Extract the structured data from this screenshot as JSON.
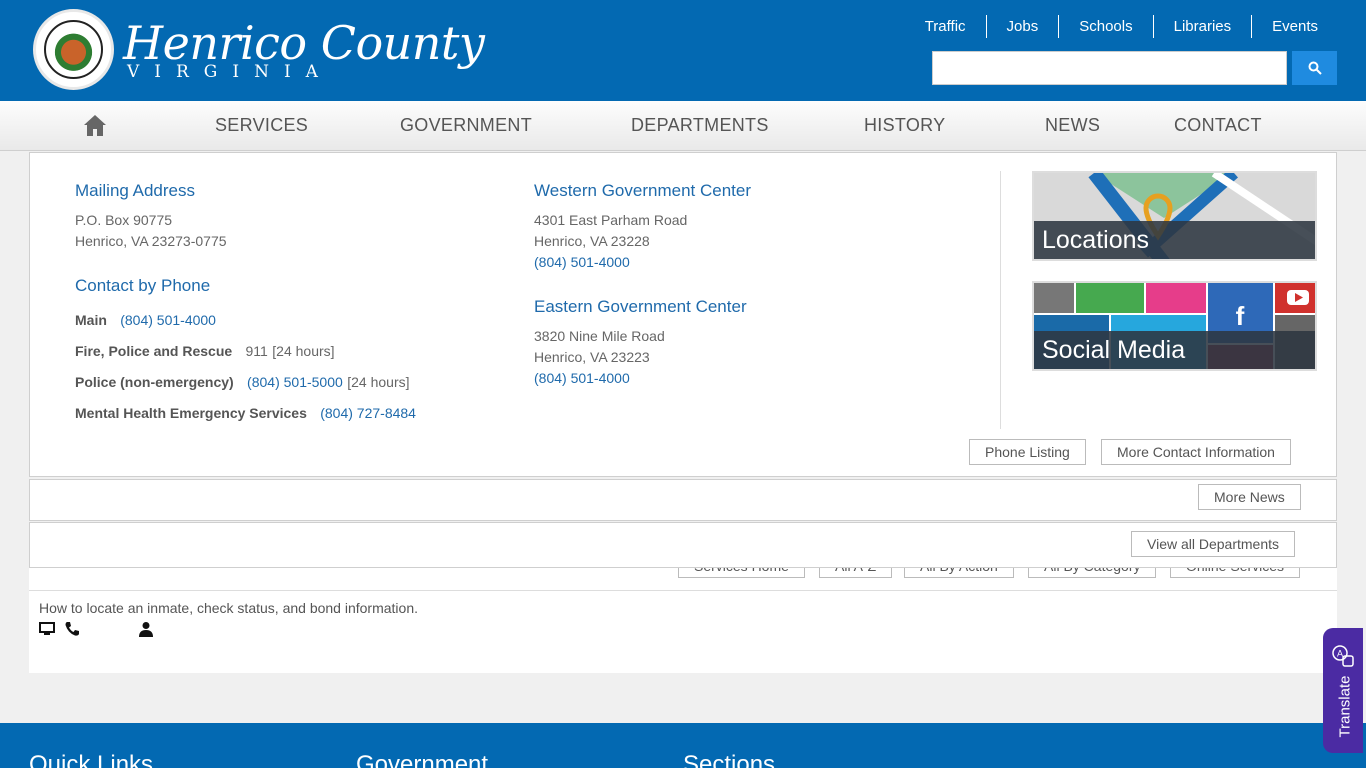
{
  "header": {
    "brand_name": "Henrico County",
    "brand_sub": "VIRGINIA",
    "top_links": [
      "Traffic",
      "Jobs",
      "Schools",
      "Libraries",
      "Events"
    ],
    "search_placeholder": ""
  },
  "nav": {
    "items": [
      "SERVICES",
      "GOVERNMENT",
      "DEPARTMENTS",
      "HISTORY",
      "NEWS",
      "CONTACT"
    ]
  },
  "contact": {
    "mailing_title": "Mailing Address",
    "mailing_line1": "P.O. Box 90775",
    "mailing_line2": "Henrico, VA 23273-0775",
    "phone_title": "Contact by Phone",
    "phones": [
      {
        "label": "Main",
        "value": "(804) 501-4000",
        "extra": ""
      },
      {
        "label": "Fire, Police and Rescue",
        "value": "911",
        "extra": "[24 hours]"
      },
      {
        "label": "Police (non-emergency)",
        "value": "(804) 501-5000",
        "extra": "[24 hours]"
      },
      {
        "label": "Mental Health Emergency Services",
        "value": "(804) 727-8484",
        "extra": ""
      }
    ],
    "western_title": "Western Government Center",
    "western_line1": "4301 East Parham Road",
    "western_line2": "Henrico, VA 23228",
    "western_phone": "(804) 501-4000",
    "eastern_title": "Eastern Government Center",
    "eastern_line1": "3820 Nine Mile Road",
    "eastern_line2": "Henrico, VA 23223",
    "eastern_phone": "(804) 501-4000",
    "tile_locations": "Locations",
    "tile_social": "Social Media",
    "phone_listing_btn": "Phone Listing",
    "more_contact_btn": "More Contact Information"
  },
  "news": {
    "more_news_btn": "More News"
  },
  "departments": {
    "view_all_btn": "View all Departments"
  },
  "services_row": [
    "Services Home",
    "All A-Z",
    "All By Action",
    "All By Category",
    "Online Services"
  ],
  "service_item": {
    "description": "How to locate an inmate, check status, and bond information."
  },
  "footer": {
    "cols": [
      "Quick Links",
      "Government",
      "Sections"
    ]
  },
  "translate": {
    "label": "Translate"
  },
  "colors": {
    "brand_blue": "#0369b2",
    "link_blue": "#1f6aab",
    "translate_purple": "#4b2ba3"
  }
}
